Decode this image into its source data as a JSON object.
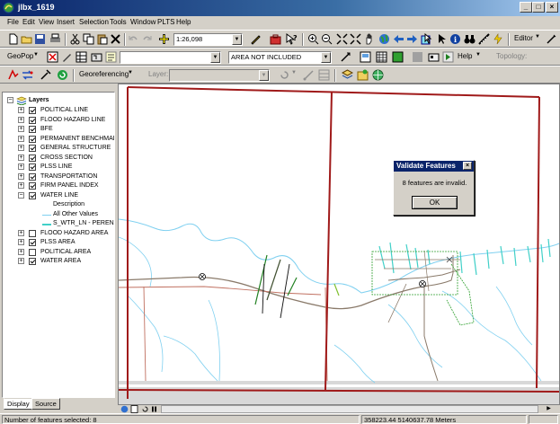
{
  "window": {
    "title": "jlbx_1619"
  },
  "menu": [
    "File",
    "Edit",
    "View",
    "Insert",
    "Selection",
    "Tools",
    "Window",
    "PLTS",
    "Help"
  ],
  "toolbar1": {
    "scale": "1:26,098",
    "editor_label": "Editor"
  },
  "toolbar2": {
    "geopop_label": "GeoPop",
    "layer_combo": "",
    "area_combo": "AREA NOT INCLUDED",
    "help_label": "Help",
    "topology_label": "Topology:"
  },
  "toolbar3": {
    "georef_label": "Georeferencing",
    "layer_label": "Layer:"
  },
  "toc": {
    "root_label": "Layers",
    "layers": [
      {
        "label": "POLITICAL LINE",
        "checked": true,
        "expanded": false
      },
      {
        "label": "FLOOD HAZARD LINE",
        "checked": true,
        "expanded": false
      },
      {
        "label": "BFE",
        "checked": true,
        "expanded": false
      },
      {
        "label": "PERMANENT BENCHMARK",
        "checked": true,
        "expanded": false
      },
      {
        "label": "GENERAL STRUCTURE",
        "checked": true,
        "expanded": false
      },
      {
        "label": "CROSS SECTION",
        "checked": true,
        "expanded": false
      },
      {
        "label": "PLSS LINE",
        "checked": true,
        "expanded": false
      },
      {
        "label": "TRANSPORTATION",
        "checked": true,
        "expanded": false
      },
      {
        "label": "FIRM PANEL INDEX",
        "checked": true,
        "expanded": false
      },
      {
        "label": "WATER LINE",
        "checked": true,
        "expanded": true
      }
    ],
    "water_legend": {
      "description": "Description",
      "items": [
        "All Other Values",
        "S_WTR_LN - PERENNIAL"
      ]
    },
    "layers_after": [
      {
        "label": "FLOOD HAZARD AREA",
        "checked": false,
        "expanded": false
      },
      {
        "label": "PLSS AREA",
        "checked": true,
        "expanded": false
      },
      {
        "label": "POLITICAL AREA",
        "checked": false,
        "expanded": false
      },
      {
        "label": "WATER AREA",
        "checked": true,
        "expanded": false
      }
    ],
    "tabs": [
      "Display",
      "Source"
    ]
  },
  "dialog": {
    "title": "Validate Features",
    "message": "8 features are invalid.",
    "ok_label": "OK"
  },
  "status": {
    "selected": "Number of features selected: 8",
    "coords": "358223.44  5140637.78 Meters"
  },
  "colors": {
    "plss": "#a01a1a",
    "water": "#7fd0f0",
    "water_perennial": "#40d0c8",
    "road": "#c07060",
    "transport": "#8a7a6a"
  }
}
